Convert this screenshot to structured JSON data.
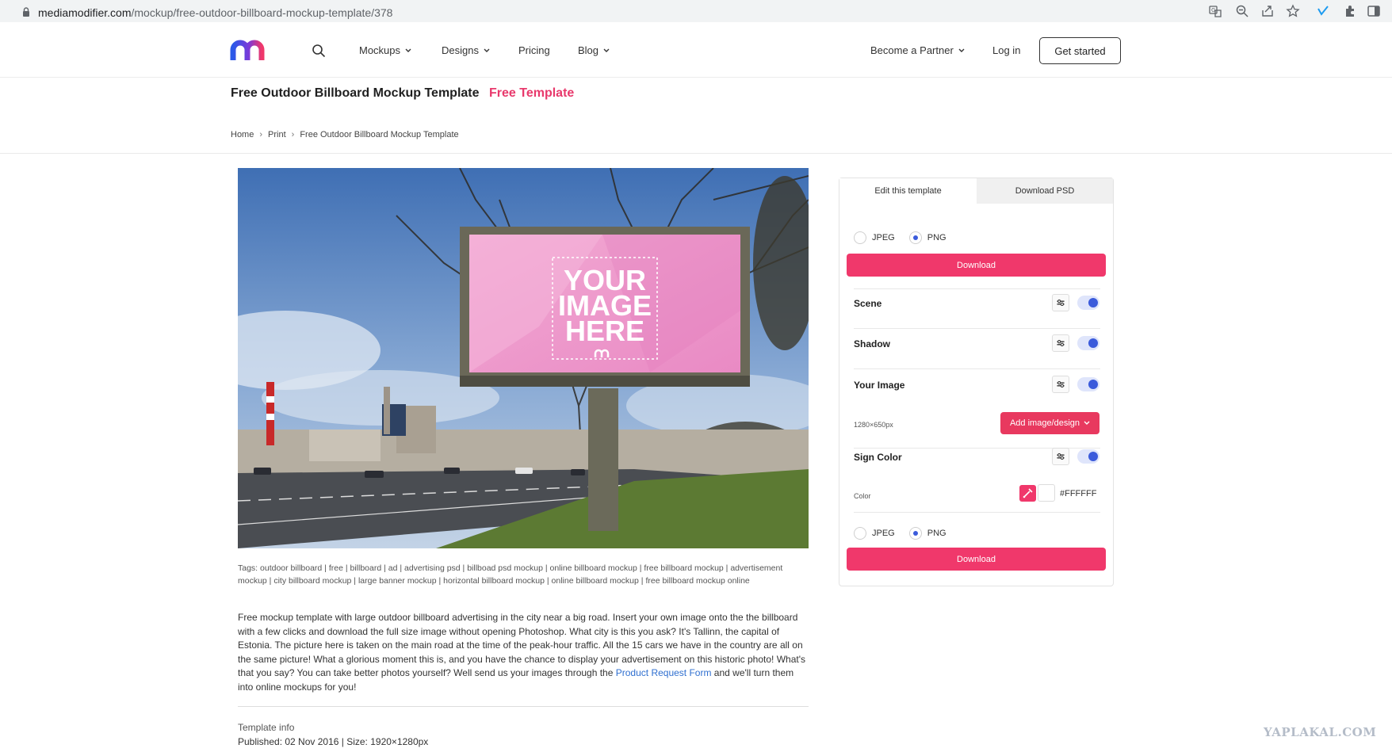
{
  "browser": {
    "url_domain": "mediamodifier.com",
    "url_path": "/mockup/free-outdoor-billboard-mockup-template/378"
  },
  "header": {
    "nav": [
      {
        "label": "Mockups"
      },
      {
        "label": "Designs"
      },
      {
        "label": "Pricing"
      },
      {
        "label": "Blog"
      }
    ],
    "partner_label": "Become a Partner",
    "login_label": "Log in",
    "get_started_label": "Get started",
    "brand_color": "#3b5bdb"
  },
  "page": {
    "title": "Free Outdoor Billboard Mockup Template",
    "badge": "Free Template",
    "badge_color": "#e8396c"
  },
  "breadcrumb": [
    "Home",
    "Print",
    "Free Outdoor Billboard Mockup Template"
  ],
  "mockup": {
    "placeholder_lines": [
      "YOUR",
      "IMAGE",
      "HERE"
    ]
  },
  "tags": {
    "prefix": "Tags:",
    "items": [
      "outdoor billboard",
      "free",
      "billboard",
      "ad",
      "advertising psd",
      "billboad psd mockup",
      "online billboard mockup",
      "free billboard mockup",
      "advertisement mockup",
      "city billboard mockup",
      "large banner mockup",
      "horizontal billboard mockup",
      "online billboard mockup",
      "free billboard mockup online"
    ]
  },
  "description": {
    "text_before_link": "Free mockup template with large outdoor billboard advertising in the city near a big road. Insert your own image onto the the billboard with a few clicks and download the full size image without opening Photoshop. What city is this you ask? It's Tallinn, the capital of Estonia. The picture here is taken on the main road at the time of the peak-hour traffic. All the 15 cars we have in the country are all on the same picture! What a glorious moment this is, and you have the chance to display your advertisement on this historic photo! What's that you say? You can take better photos yourself? Well send us your images through the ",
    "link_text": "Product Request Form",
    "text_after_link": " and we'll turn them into online mockups for you!"
  },
  "template_info": {
    "label": "Template info",
    "published": "Published: 02 Nov 2016 | Size: 1920×1280px"
  },
  "panel": {
    "tabs": [
      {
        "label": "Edit this template"
      },
      {
        "label": "Download PSD"
      }
    ],
    "format_options": [
      "JPEG",
      "PNG"
    ],
    "selected_format": "PNG",
    "download_label": "Download",
    "scene_label": "Scene",
    "shadow_label": "Shadow",
    "your_image_label": "Your Image",
    "image_size": "1280×650px",
    "add_image_label": "Add image/design",
    "sign_color_label": "Sign Color",
    "color_label": "Color",
    "color_value": "#FFFFFF",
    "accent_color": "#f0386b"
  },
  "watermark": "YAPLAKAL.COM"
}
